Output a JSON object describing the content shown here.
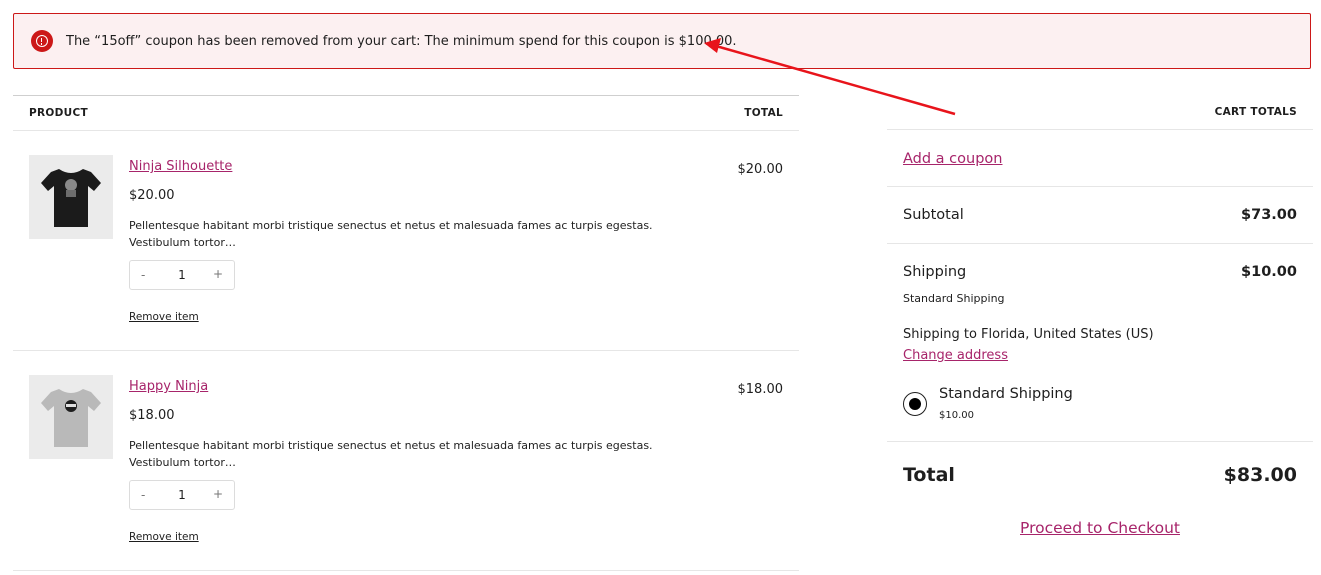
{
  "notice": {
    "message": "The “15off” coupon has been removed from your cart: The minimum spend for this coupon is $100.00.",
    "icon": "error-icon",
    "color": "#cc1818"
  },
  "cart": {
    "headers": {
      "product": "PRODUCT",
      "total": "TOTAL"
    },
    "items": [
      {
        "name": "Ninja Silhouette",
        "price": "$20.00",
        "description": "Pellentesque habitant morbi tristique senectus et netus et malesuada fames ac turpis egestas. Vestibulum tortor…",
        "quantity": "1",
        "qty_minus": "-",
        "qty_plus": "+",
        "remove_label": "Remove item",
        "line_total": "$20.00",
        "shirt_color": "#1b1b1b"
      },
      {
        "name": "Happy Ninja",
        "price": "$18.00",
        "description": "Pellentesque habitant morbi tristique senectus et netus et malesuada fames ac turpis egestas. Vestibulum tortor…",
        "quantity": "1",
        "qty_minus": "-",
        "qty_plus": "+",
        "remove_label": "Remove item",
        "line_total": "$18.00",
        "shirt_color": "#b9b9b9"
      }
    ]
  },
  "totals": {
    "heading": "CART TOTALS",
    "add_coupon": "Add a coupon",
    "subtotal_label": "Subtotal",
    "subtotal_value": "$73.00",
    "shipping_label": "Shipping",
    "shipping_value": "$10.00",
    "shipping_method": "Standard Shipping",
    "shipping_destination": "Shipping to Florida, United States (US)",
    "change_address": "Change address",
    "option_name": "Standard Shipping",
    "option_price": "$10.00",
    "total_label": "Total",
    "total_value": "$83.00",
    "checkout_label": "Proceed to Checkout"
  },
  "colors": {
    "accent": "#a7246a",
    "error": "#cc1818",
    "annotation_arrow": "#e8141b"
  }
}
